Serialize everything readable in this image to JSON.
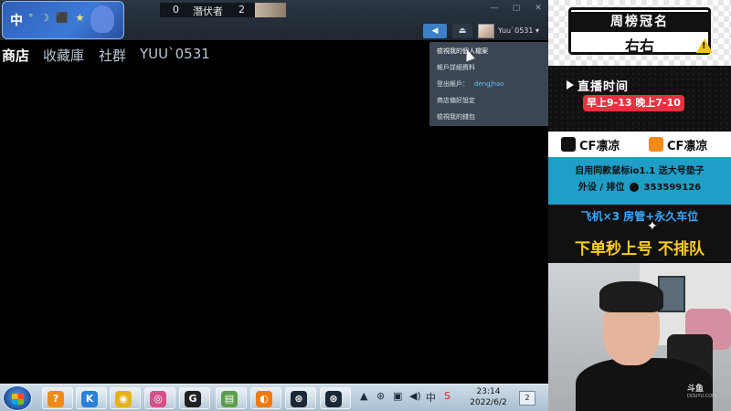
{
  "ime": {
    "mode_label": "中",
    "glyphs": "° ☽ ⬛ ★"
  },
  "scoreboard": {
    "left_score": "0",
    "team_name": "潛伏者",
    "right_score": "2"
  },
  "window_controls": {
    "minimize": "—",
    "maximize": "▢",
    "close": "✕"
  },
  "nav": {
    "items": [
      "商店",
      "收藏庫",
      "社群",
      "YUU`0531"
    ]
  },
  "header": {
    "broadcast_icon": "◀",
    "notification_icon": "⏏",
    "username": "Yuu`0531 ▾"
  },
  "account_menu": {
    "items": [
      {
        "label": "檢視我的個人檔案",
        "sub": ""
      },
      {
        "label": "帳戶詳細資料",
        "sub": ""
      },
      {
        "label": "登出帳戶：",
        "sub": "dengjhao"
      },
      {
        "label": "商店偏好設定",
        "sub": ""
      },
      {
        "label": "檢視我的錢包",
        "sub": ""
      }
    ]
  },
  "taskbar": {
    "clock_time": "23:14",
    "clock_date": "2022/6/2",
    "notification_count": "2",
    "tray_ime": "中",
    "apps": [
      {
        "name": "app-1",
        "glyph": "?",
        "color": "#f08a16"
      },
      {
        "name": "app-2",
        "glyph": "K",
        "color": "#2a7fd8"
      },
      {
        "name": "app-3",
        "glyph": "◉",
        "color": "#e5b318"
      },
      {
        "name": "app-4",
        "glyph": "◎",
        "color": "#d94f8c"
      },
      {
        "name": "app-5",
        "glyph": "G",
        "color": "#222222"
      },
      {
        "name": "app-6",
        "glyph": "▤",
        "color": "#5a9e4a"
      },
      {
        "name": "app-7",
        "glyph": "◐",
        "color": "#f07a12"
      },
      {
        "name": "app-8",
        "glyph": "⊛",
        "color": "#1b2838"
      },
      {
        "name": "app-9",
        "glyph": "⊛",
        "color": "#1b2838"
      }
    ]
  },
  "overlay": {
    "rank_title": "周榜冠名",
    "rank_name": "右右",
    "live_title": "直播时间",
    "live_hours": "早上9-13 晚上7-10",
    "promo_brand_left": "CF凛凉",
    "promo_brand_right": "CF凛凉",
    "promo_line1": "自用同款鼠标io1.1 送大号垫子",
    "promo_line2_prefix": "外设 / 排位",
    "promo_line2_number": "353599126",
    "sale_line1": "飞机×3  房管+永久车位",
    "sale_line2": "下单秒上号 不排队",
    "cam_watermark": "斗鱼",
    "cam_watermark_sub": "DOUYU.COM"
  },
  "colors": {
    "steam_accent": "#66c0f4",
    "broadcast_blue": "#3d7fc4",
    "live_red": "#e8323f",
    "sale_yellow": "#ffcf1a",
    "sale_blue": "#3aa7ff",
    "promo_cyan": "#1f9ec7"
  }
}
